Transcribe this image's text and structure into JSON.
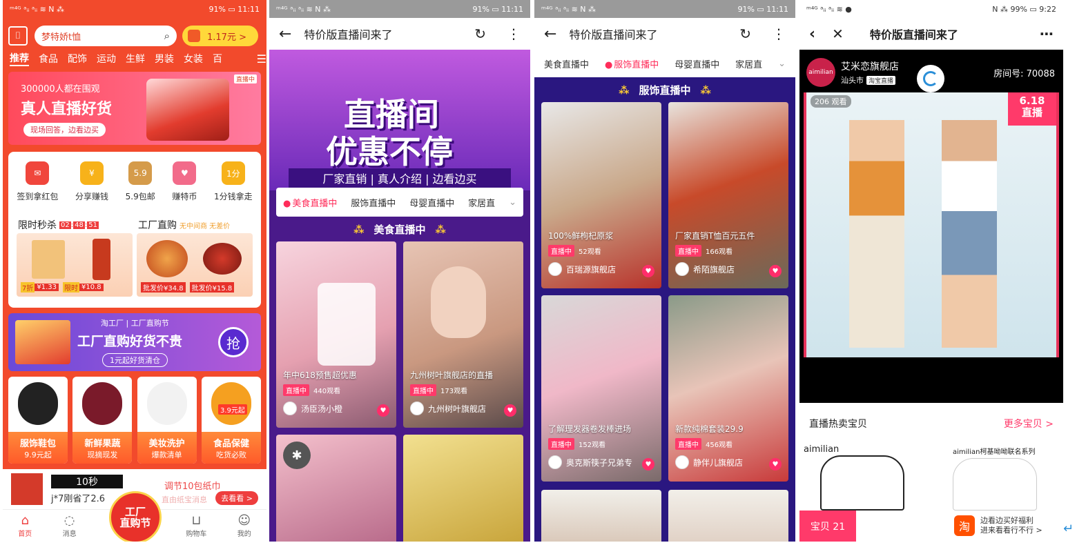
{
  "status": {
    "p1": {
      "left": "ᵐ⁴ᴳ ᵃᵢᵢ ᵃᵢᵢ ≋ N ⁂",
      "right": "91% ▭ 11:11"
    },
    "p2": {
      "left": "ᵐ⁴ᴳ ᵃᵢᵢ ᵃᵢᵢ ≋ N ⁂",
      "right": "91% ▭ 11:11"
    },
    "p3": {
      "left": "ᵐ⁴ᴳ ᵃᵢᵢ ᵃᵢᵢ ≋ N ⁂",
      "right": "91% ▭ 11:11"
    },
    "p4": {
      "left": "ᵐ⁴ᴳ ᵃᵢᵢ ᵃᵢᵢ ≋ ●",
      "right": "N ⁂ 99% ▭ 9:22"
    }
  },
  "home": {
    "search_placeholder": "梦特娇t恤",
    "coin_value": "1.17元 >",
    "categories": [
      "推荐",
      "食品",
      "配饰",
      "运动",
      "生鲜",
      "男装",
      "女装",
      "百"
    ],
    "banner": {
      "viewers": "300000人都在围观",
      "headline": "真人直播好货",
      "sub": "现场回答，边看边买",
      "badge": "直播中"
    },
    "quick": [
      {
        "label": "签到拿红包",
        "glyph": "✉",
        "color": "#f0463c"
      },
      {
        "label": "分享赚钱",
        "glyph": "¥",
        "color": "#f7b21a"
      },
      {
        "label": "5.9包邮",
        "glyph": "5.9",
        "color": "#d59b4a"
      },
      {
        "label": "赚特币",
        "glyph": "♥",
        "color": "#f26b8a"
      },
      {
        "label": "1分钱拿走",
        "glyph": "1分",
        "color": "#f7b21a"
      }
    ],
    "flash": {
      "title": "限时秒杀",
      "h": "02",
      "m": "48",
      "s": "51",
      "tag1": "7折",
      "price1": "¥1.33",
      "tag2": "限时",
      "price2": "¥10.8"
    },
    "factory": {
      "title": "工厂直购",
      "sub": "无中间商 无差价",
      "price1": "批发价¥34.8",
      "price2": "批发价¥15.8"
    },
    "promo": {
      "top": "淘工厂 | 工厂直购节",
      "headline": "工厂直购好货不贵",
      "sub": "1元起好货清仓",
      "btn": "抢"
    },
    "tiles": [
      {
        "title": "服饰鞋包",
        "sub": "9.9元起"
      },
      {
        "title": "新鲜果蔬",
        "sub": "现摘现发"
      },
      {
        "title": "美妆洗护",
        "sub": "爆款清单"
      },
      {
        "title": "食品保健",
        "sub": "吃货必败"
      }
    ],
    "tile_badge": "3.9元起",
    "ticker": {
      "num": "10秒",
      "user": "j*7刚省了2.6",
      "text": "调节10包纸巾",
      "text2": "直由纸宝消息",
      "btn": "去看看 >"
    },
    "fab": [
      "工厂",
      "直购节"
    ],
    "nav": [
      "首页",
      "消息",
      "购物车",
      "我的"
    ]
  },
  "live": {
    "title": "特价版直播间来了",
    "hero_line1": "直播间",
    "hero_line2": "优惠不停",
    "hero_strip": "厂家直销 | 真人介绍 | 边看边买",
    "tabs": [
      "美食直播中",
      "服饰直播中",
      "母婴直播中",
      "家居直"
    ],
    "food": {
      "section": "美食直播中",
      "cards": [
        {
          "title": "年中618预售超优惠",
          "views": "440观看",
          "shop": "汤臣汤小橙"
        },
        {
          "title": "九州树叶旗舰店的直播",
          "views": "173观看",
          "shop": "九州树叶旗舰店"
        }
      ]
    },
    "fashion": {
      "section": "服饰直播中",
      "cards": [
        {
          "title": "100%鲜枸杞原浆",
          "views": "52观看",
          "shop": "百瑞源旗舰店"
        },
        {
          "title": "厂家直销T恤百元五件",
          "views": "166观看",
          "shop": "希陌旗舰店"
        },
        {
          "title": "了解理发器卷发棒进场",
          "views": "152观看",
          "shop": "奥克斯筷子兄弟专"
        },
        {
          "title": "新款纯棉套装29.9",
          "views": "456观看",
          "shop": "静伴儿旗舰店"
        }
      ]
    },
    "live_badge": "直播中"
  },
  "room": {
    "title": "特价版直播间来了",
    "shop": "艾米恋旗舰店",
    "location": "汕头市",
    "tb_tag": "淘宝直播",
    "logo_text": "aimilian",
    "room_no": "房间号: 70088",
    "views": "206 观看",
    "promo": [
      "6.18",
      "直播"
    ],
    "hot_title": "直播热卖宝贝",
    "more": "更多宝贝 >",
    "brand1": "aimilian",
    "brand2": "aimilian柯基呦呦联名系列",
    "count": "宝贝 21",
    "tb_icon": "淘",
    "tb_text1": "边看边买好福利",
    "tb_text2": "进来看看行不行 >"
  },
  "colors": {
    "accent": "#ff3a6a",
    "taobao_orange": "#ff5000",
    "live_purple": "#4a1a8a"
  }
}
